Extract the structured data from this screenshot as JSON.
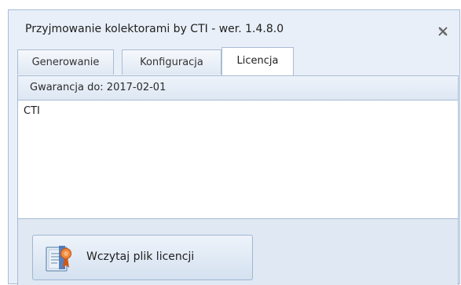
{
  "window": {
    "title": "Przyjmowanie kolektorami by CTI -  wer. 1.4.8.0"
  },
  "tabs": [
    {
      "label": "Generowanie",
      "active": false
    },
    {
      "label": "Konfiguracja",
      "active": false
    },
    {
      "label": "Licencja",
      "active": true
    }
  ],
  "license": {
    "warranty_label": "Gwarancja do: 2017-02-01",
    "text": "CTI",
    "load_button_label": "Wczytaj plik licencji"
  },
  "icons": {
    "close": "close-icon",
    "certificate": "certificate-icon"
  },
  "colors": {
    "window_bg": "#e8eff8",
    "border": "#a9bcd4",
    "accent_orange": "#e8752a"
  }
}
